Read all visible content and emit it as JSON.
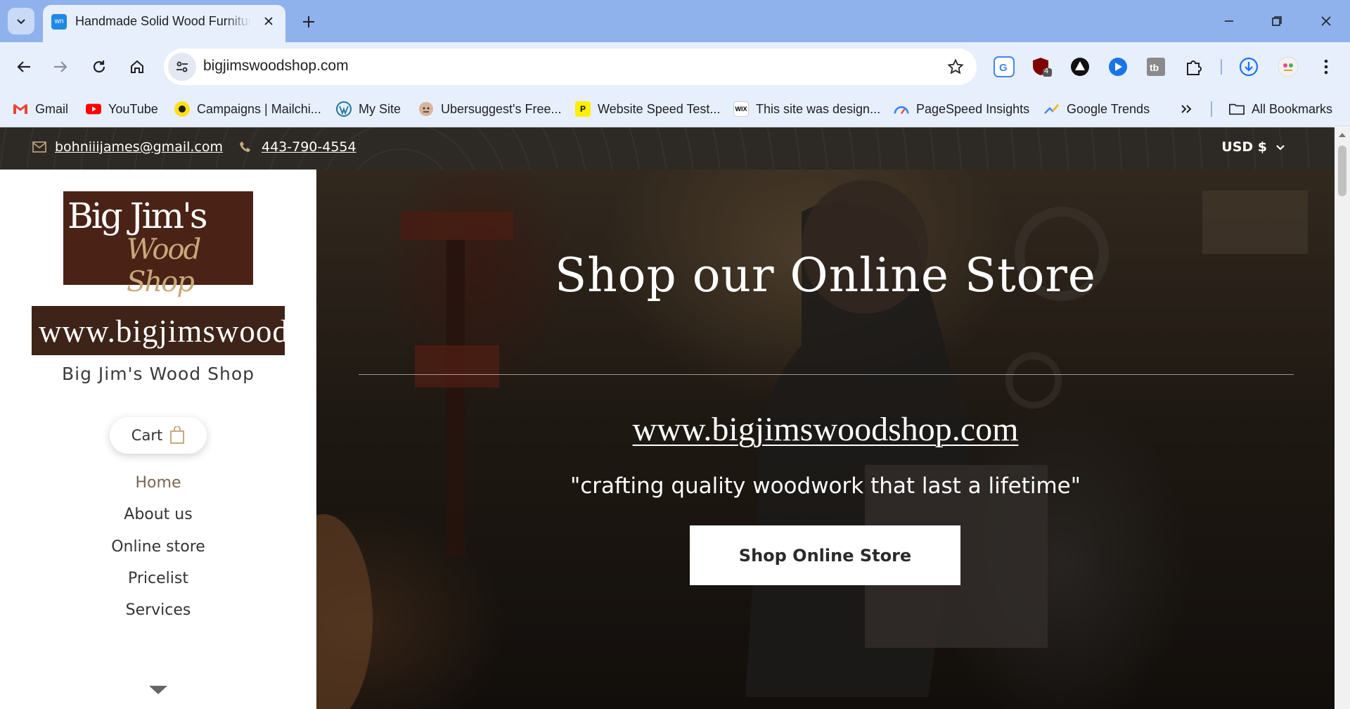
{
  "browser": {
    "tab_title": "Handmade Solid Wood Furniture",
    "tab_favicon_text": "wn",
    "url": "bigjimswoodshop.com",
    "extension_badge": "4",
    "bookmarks": [
      {
        "label": "Gmail",
        "icon": "gmail-icon"
      },
      {
        "label": "YouTube",
        "icon": "youtube-icon"
      },
      {
        "label": "Campaigns | Mailchi...",
        "icon": "mailchimp-icon"
      },
      {
        "label": "My Site",
        "icon": "wordpress-icon"
      },
      {
        "label": "Ubersuggest's Free...",
        "icon": "ubersuggest-icon"
      },
      {
        "label": "Website Speed Test...",
        "icon": "pingdom-icon"
      },
      {
        "label": "This site was design...",
        "icon": "wix-icon"
      },
      {
        "label": "PageSpeed Insights",
        "icon": "pagespeed-icon"
      },
      {
        "label": "Google Trends",
        "icon": "trends-icon"
      }
    ],
    "all_bookmarks": "All Bookmarks",
    "wix_icon_text": "WIX",
    "pingdom_icon_text": "P"
  },
  "topbar": {
    "email": "bohniiijames@gmail.com",
    "phone": "443-790-4554",
    "currency": "USD $"
  },
  "sidebar": {
    "logo_text_top": "Big Jim's",
    "logo_text_script": "Wood Shop",
    "site_banner": "www.bigjimswoodshop.com",
    "shop_name": "Big Jim's Wood Shop",
    "cart_label": "Cart",
    "nav": [
      {
        "label": "Home",
        "active": true
      },
      {
        "label": "About us"
      },
      {
        "label": "Online store"
      },
      {
        "label": "Pricelist"
      },
      {
        "label": "Services"
      }
    ]
  },
  "hero": {
    "title": "Shop our Online Store",
    "url": "www.bigjimswoodshop.com",
    "tagline": "\"crafting quality woodwork that last a lifetime\"",
    "button": "Shop Online Store"
  },
  "colors": {
    "tabstrip": "#8fb2ec",
    "toolbar": "#e7effc",
    "topbar": "#2d2925",
    "logo_bg": "#4a2216",
    "nav_active": "#7a6652"
  }
}
